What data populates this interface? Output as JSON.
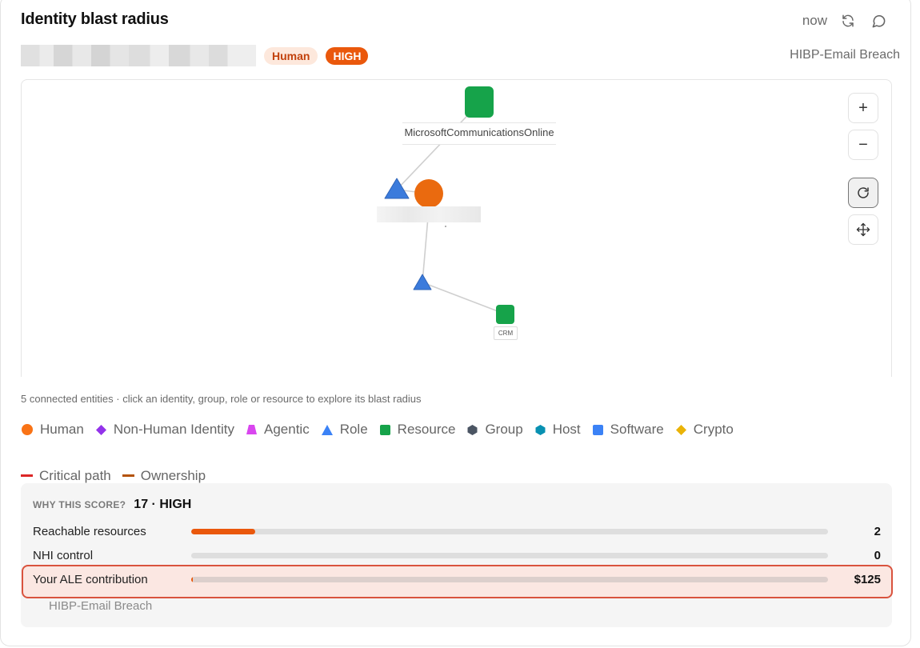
{
  "header": {
    "title": "Identity blast radius",
    "time_label": "now",
    "refresh_icon": "refresh-icon",
    "comment_icon": "comment-icon"
  },
  "identity": {
    "badge_type": "Human",
    "badge_risk": "HIGH",
    "source": "HIBP-Email Breach"
  },
  "graph": {
    "node_labels": {
      "top_resource": "MicrosoftCommunicationsOnline",
      "bottom_resource": "CRM"
    },
    "controls": {
      "zoom_in": "+",
      "zoom_out": "−",
      "reset_icon": "reset-icon",
      "pan_icon": "move-icon"
    }
  },
  "summary": {
    "connected_count": "5 connected entities",
    "hint": "· click an identity, group, role or resource to explore its blast radius"
  },
  "legend": [
    {
      "label": "Human",
      "shape": "circle",
      "color": "#f97316"
    },
    {
      "label": "Non-Human Identity",
      "shape": "diamond",
      "color": "#9333ea"
    },
    {
      "label": "Agentic",
      "shape": "trapezoid",
      "color": "#d946ef"
    },
    {
      "label": "Role",
      "shape": "triangle",
      "color": "#3b82f6"
    },
    {
      "label": "Resource",
      "shape": "square",
      "color": "#16a34a"
    },
    {
      "label": "Group",
      "shape": "hexagon",
      "color": "#4b5563"
    },
    {
      "label": "Host",
      "shape": "hexagon",
      "color": "#0891b2"
    },
    {
      "label": "Software",
      "shape": "square",
      "color": "#3b82f6"
    },
    {
      "label": "Crypto",
      "shape": "diamond",
      "color": "#eab308"
    }
  ],
  "edge_legend": [
    {
      "label": "Critical path",
      "color": "#dc2626"
    },
    {
      "label": "Ownership",
      "color": "#b45309"
    }
  ],
  "score": {
    "why_label": "WHY THIS SCORE?",
    "value": "17 · HIGH",
    "metrics": [
      {
        "label": "Reachable resources",
        "value": "2",
        "fill": 0.1
      },
      {
        "label": "NHI control",
        "value": "0",
        "fill": 0.0
      },
      {
        "label": "Your ALE contribution",
        "value": "$125",
        "fill": 0.002
      }
    ],
    "ale_source": "HIBP-Email Breach"
  },
  "colors": {
    "accent": "#ea580c",
    "highlight_border": "#d9533e",
    "highlight_bg": "#fbe7e2"
  }
}
